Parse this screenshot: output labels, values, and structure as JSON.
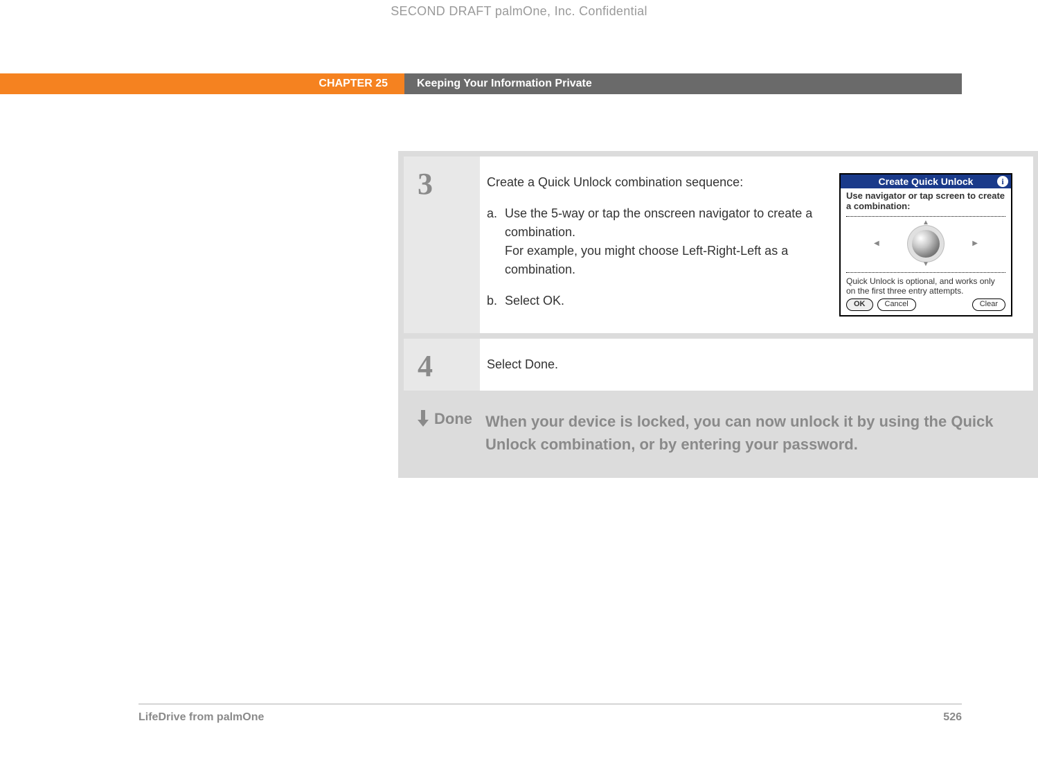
{
  "watermark": "SECOND DRAFT palmOne, Inc.  Confidential",
  "header": {
    "chapter": "CHAPTER 25",
    "section": "Keeping Your Information Private"
  },
  "steps": {
    "s3": {
      "num": "3",
      "intro": "Create a Quick Unlock combination sequence:",
      "a_marker": "a.",
      "a_line1": "Use the 5-way or tap the onscreen navigator to create a combination.",
      "a_line2": "For example, you might choose Left-Right-Left as a combination.",
      "b_marker": "b.",
      "b_text": "Select OK."
    },
    "s4": {
      "num": "4",
      "text": "Select Done."
    }
  },
  "palm": {
    "title": "Create Quick Unlock",
    "instr": "Use navigator or tap screen to create a combination:",
    "note": "Quick Unlock is optional, and works only on the first three entry attempts.",
    "arrows": {
      "up": "▲",
      "down": "▼",
      "left": "◀",
      "right": "▶"
    },
    "btn_ok": "OK",
    "btn_cancel": "Cancel",
    "btn_clear": "Clear"
  },
  "done": {
    "label": "Done",
    "text": "When your device is locked, you can now unlock it by using the Quick Unlock combination, or by entering your password."
  },
  "footer": {
    "left": "LifeDrive from palmOne",
    "right": "526"
  }
}
